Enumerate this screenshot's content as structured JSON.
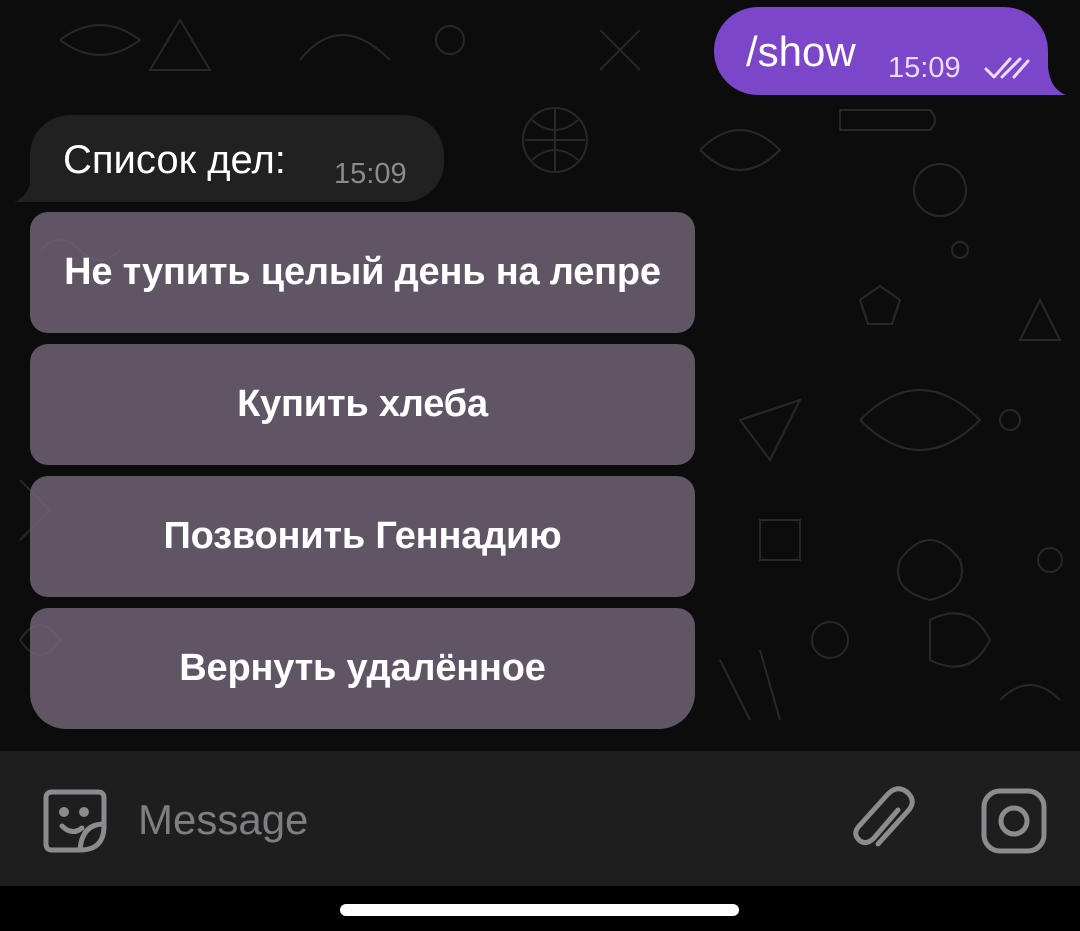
{
  "outgoing_message": {
    "text": "/show",
    "time": "15:09",
    "status_icon": "double-check-icon"
  },
  "incoming_message": {
    "text": "Список дел:",
    "time": "15:09"
  },
  "inline_keyboard": {
    "buttons": [
      {
        "label": "Не тупить целый день на лепре"
      },
      {
        "label": "Купить хлеба"
      },
      {
        "label": "Позвонить Геннадию"
      },
      {
        "label": "Вернуть удалённое"
      }
    ]
  },
  "composer": {
    "placeholder": "Message",
    "value": "",
    "emoji_icon": "sticker-smile-icon",
    "attach_icon": "paperclip-icon",
    "camera_icon": "camera-icon"
  },
  "colors": {
    "outgoing_bubble": "#7b46c9",
    "incoming_bubble": "#212121",
    "keyboard_button": "#706376",
    "input_bar": "#1e1e1e",
    "background": "#0c0c0d"
  }
}
